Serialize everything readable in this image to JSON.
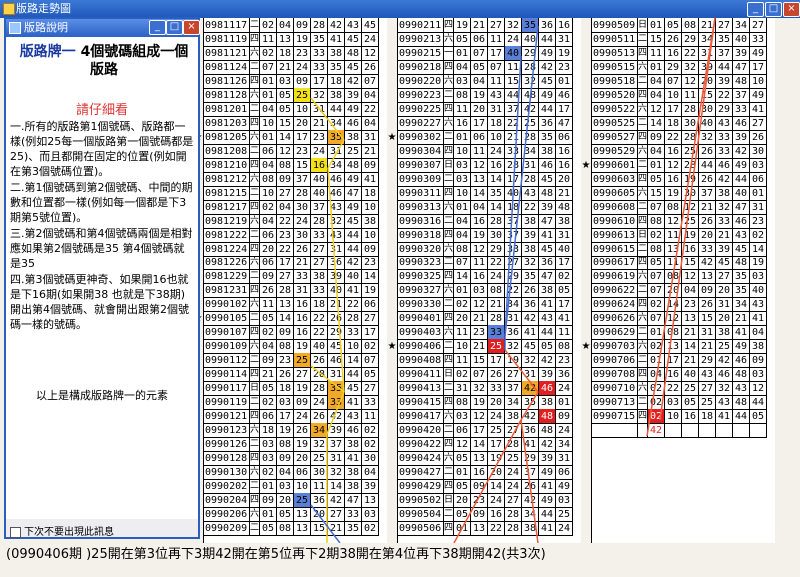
{
  "window": {
    "title": "版路走勢圖"
  },
  "popup": {
    "title": "版路說明",
    "heading_part1": "版路牌一",
    "heading_part2": "4個號碼組成一個版路",
    "subheading": "請仔細看",
    "items": [
      "一.所有的版路第1個號碼、版路都一樣(例如25每一個版路第一個號碼都是25)、而且都開在固定的位置(例如開在第3個號碼位置)。",
      "二.第1個號碼到第2個號碼、中間的期數和位置都一樣(例如每一個都是下3期第5號位置)。",
      "三.第2個號碼和第4個號碼兩個是相對應如果第2個號碼是35 第4個號碼就是35",
      "四.第3個號碼更神奇、如果開16也就是下16期(如果開38 也就是下38期)開出第4個號碼、就會開出跟第2個號碼一樣的號碼。"
    ],
    "conclusion": "以上是構成版路牌一的元素",
    "checkbox_label": "下次不要出現此訊息"
  },
  "status": "(0990406期 )25開在第3位再下3期42開在第5位再下2期38開在第4位再下38期開42(共3次)",
  "colors": {
    "yellow": "#f4e218",
    "orange": "#f2a92a",
    "red": "#e02020",
    "blue": "#5a7fd8",
    "line_red": "#ee5a3a",
    "line_yellow": "#f0d020",
    "line_blue": "#4a6fd0"
  },
  "columns": [
    {
      "rows": [
        [
          "0981117",
          "二",
          "02",
          "04",
          "09",
          "28",
          "42",
          "43",
          "45"
        ],
        [
          "0981119",
          "四",
          "11",
          "13",
          "19",
          "35",
          "41",
          "45",
          "24"
        ],
        [
          "0981121",
          "六",
          "02",
          "18",
          "23",
          "33",
          "38",
          "48",
          "12"
        ],
        [
          "0981124",
          "二",
          "07",
          "21",
          "24",
          "33",
          "35",
          "45",
          "26"
        ],
        [
          "0981126",
          "四",
          "01",
          "03",
          "09",
          "17",
          "18",
          "42",
          "07"
        ],
        [
          "0981128",
          "六",
          "01",
          "05",
          "25",
          "32",
          "38",
          "39",
          "04"
        ],
        [
          "0981201",
          "二",
          "04",
          "05",
          "10",
          "31",
          "44",
          "49",
          "22"
        ],
        [
          "0981203",
          "四",
          "10",
          "15",
          "20",
          "21",
          "34",
          "46",
          "04"
        ],
        [
          "0981205",
          "六",
          "01",
          "14",
          "17",
          "23",
          "35",
          "38",
          "31"
        ],
        [
          "0981208",
          "二",
          "06",
          "12",
          "23",
          "24",
          "31",
          "25",
          "21"
        ],
        [
          "0981210",
          "四",
          "04",
          "08",
          "15",
          "16",
          "34",
          "48",
          "09"
        ],
        [
          "0981212",
          "六",
          "08",
          "09",
          "37",
          "40",
          "46",
          "49",
          "41"
        ],
        [
          "0981215",
          "二",
          "10",
          "27",
          "28",
          "40",
          "46",
          "47",
          "18"
        ],
        [
          "0981217",
          "四",
          "02",
          "04",
          "30",
          "37",
          "43",
          "49",
          "10"
        ],
        [
          "0981219",
          "六",
          "04",
          "22",
          "24",
          "28",
          "32",
          "45",
          "38"
        ],
        [
          "0981222",
          "二",
          "06",
          "23",
          "30",
          "33",
          "43",
          "44",
          "10"
        ],
        [
          "0981224",
          "四",
          "20",
          "22",
          "26",
          "27",
          "31",
          "44",
          "09"
        ],
        [
          "0981226",
          "六",
          "06",
          "17",
          "21",
          "27",
          "36",
          "42",
          "23"
        ],
        [
          "0981229",
          "二",
          "09",
          "27",
          "33",
          "38",
          "39",
          "40",
          "14"
        ],
        [
          "0981231",
          "四",
          "26",
          "28",
          "31",
          "33",
          "40",
          "41",
          "19"
        ],
        [
          "0990102",
          "六",
          "11",
          "13",
          "16",
          "18",
          "21",
          "22",
          "06"
        ],
        [
          "0990105",
          "二",
          "05",
          "14",
          "16",
          "22",
          "26",
          "28",
          "27"
        ],
        [
          "0990107",
          "四",
          "02",
          "09",
          "16",
          "22",
          "29",
          "33",
          "17"
        ],
        [
          "0990109",
          "六",
          "04",
          "08",
          "19",
          "40",
          "45",
          "10",
          "02"
        ],
        [
          "0990112",
          "二",
          "09",
          "23",
          "25",
          "26",
          "46",
          "14",
          "07"
        ],
        [
          "0990114",
          "四",
          "21",
          "26",
          "27",
          "28",
          "31",
          "44",
          "05"
        ],
        [
          "0990117",
          "日",
          "05",
          "18",
          "19",
          "28",
          "35",
          "45",
          "27"
        ],
        [
          "0990119",
          "二",
          "02",
          "03",
          "09",
          "24",
          "33",
          "41",
          "33"
        ],
        [
          "0990121",
          "四",
          "06",
          "17",
          "24",
          "26",
          "42",
          "43",
          "11"
        ],
        [
          "0990123",
          "六",
          "18",
          "19",
          "26",
          "34",
          "39",
          "46",
          "02"
        ],
        [
          "0990126",
          "二",
          "03",
          "08",
          "19",
          "32",
          "37",
          "38",
          "02"
        ],
        [
          "0990128",
          "四",
          "03",
          "09",
          "20",
          "25",
          "31",
          "41",
          "30"
        ],
        [
          "0990130",
          "六",
          "02",
          "04",
          "06",
          "30",
          "32",
          "38",
          "04"
        ],
        [
          "0990202",
          "二",
          "01",
          "03",
          "10",
          "11",
          "14",
          "38",
          "39"
        ],
        [
          "0990204",
          "四",
          "09",
          "20",
          "25",
          "36",
          "42",
          "47",
          "13"
        ],
        [
          "0990206",
          "六",
          "01",
          "05",
          "13",
          "20",
          "27",
          "33",
          "03"
        ],
        [
          "0990209",
          "二",
          "05",
          "08",
          "13",
          "15",
          "21",
          "35",
          "02"
        ]
      ]
    },
    {
      "rows": [
        [
          "0990211",
          "四",
          "19",
          "21",
          "27",
          "32",
          "35",
          "36",
          "16"
        ],
        [
          "0990213",
          "六",
          "05",
          "06",
          "11",
          "24",
          "40",
          "44",
          "31"
        ],
        [
          "0990215",
          "一",
          "01",
          "07",
          "17",
          "40",
          "29",
          "49",
          "19"
        ],
        [
          "0990218",
          "四",
          "04",
          "05",
          "07",
          "11",
          "28",
          "42",
          "23"
        ],
        [
          "0990220",
          "六",
          "03",
          "04",
          "11",
          "15",
          "32",
          "45",
          "01"
        ],
        [
          "0990223",
          "二",
          "08",
          "19",
          "43",
          "44",
          "48",
          "49",
          "46"
        ],
        [
          "0990225",
          "四",
          "11",
          "20",
          "31",
          "37",
          "42",
          "44",
          "17"
        ],
        [
          "0990227",
          "六",
          "16",
          "17",
          "18",
          "22",
          "25",
          "36",
          "47"
        ],
        [
          "0990302",
          "二",
          "01",
          "06",
          "10",
          "21",
          "28",
          "35",
          "06"
        ],
        [
          "0990304",
          "四",
          "10",
          "11",
          "24",
          "33",
          "34",
          "38",
          "16"
        ],
        [
          "0990307",
          "日",
          "03",
          "12",
          "16",
          "28",
          "31",
          "46",
          "16"
        ],
        [
          "0990309",
          "二",
          "03",
          "13",
          "14",
          "17",
          "28",
          "45",
          "20"
        ],
        [
          "0990311",
          "四",
          "10",
          "14",
          "35",
          "40",
          "43",
          "48",
          "21"
        ],
        [
          "0990313",
          "六",
          "01",
          "04",
          "14",
          "18",
          "22",
          "39",
          "48"
        ],
        [
          "0990316",
          "二",
          "04",
          "16",
          "28",
          "37",
          "38",
          "47",
          "38"
        ],
        [
          "0990318",
          "四",
          "04",
          "19",
          "30",
          "37",
          "39",
          "41",
          "31"
        ],
        [
          "0990320",
          "六",
          "08",
          "12",
          "29",
          "33",
          "38",
          "45",
          "40"
        ],
        [
          "0990323",
          "二",
          "07",
          "11",
          "22",
          "27",
          "32",
          "36",
          "17"
        ],
        [
          "0990325",
          "四",
          "14",
          "16",
          "24",
          "29",
          "35",
          "47",
          "02"
        ],
        [
          "0990327",
          "六",
          "01",
          "03",
          "08",
          "22",
          "26",
          "38",
          "05"
        ],
        [
          "0990330",
          "二",
          "02",
          "12",
          "21",
          "34",
          "36",
          "41",
          "17"
        ],
        [
          "0990401",
          "四",
          "20",
          "21",
          "28",
          "31",
          "42",
          "43",
          "41"
        ],
        [
          "0990403",
          "六",
          "11",
          "23",
          "33",
          "36",
          "41",
          "44",
          "11"
        ],
        [
          "0990406",
          "二",
          "10",
          "21",
          "25",
          "32",
          "45",
          "05",
          "08"
        ],
        [
          "0990408",
          "四",
          "11",
          "15",
          "17",
          "19",
          "32",
          "42",
          "23"
        ],
        [
          "0990411",
          "日",
          "02",
          "07",
          "26",
          "27",
          "31",
          "39",
          "36"
        ],
        [
          "0990413",
          "二",
          "31",
          "32",
          "33",
          "37",
          "42",
          "46",
          "24"
        ],
        [
          "0990415",
          "四",
          "08",
          "19",
          "20",
          "34",
          "35",
          "38",
          "01"
        ],
        [
          "0990417",
          "六",
          "03",
          "12",
          "24",
          "38",
          "42",
          "48",
          "09"
        ],
        [
          "0990420",
          "二",
          "06",
          "17",
          "25",
          "27",
          "36",
          "48",
          "24"
        ],
        [
          "0990422",
          "四",
          "12",
          "14",
          "17",
          "28",
          "41",
          "42",
          "34"
        ],
        [
          "0990424",
          "六",
          "05",
          "13",
          "19",
          "25",
          "29",
          "39",
          "31"
        ],
        [
          "0990427",
          "二",
          "01",
          "16",
          "20",
          "24",
          "37",
          "49",
          "06"
        ],
        [
          "0990429",
          "四",
          "05",
          "09",
          "14",
          "24",
          "26",
          "41",
          "49"
        ],
        [
          "0990502",
          "日",
          "20",
          "23",
          "24",
          "27",
          "42",
          "49",
          "03"
        ],
        [
          "0990504",
          "二",
          "05",
          "09",
          "16",
          "28",
          "34",
          "44",
          "25"
        ],
        [
          "0990506",
          "四",
          "01",
          "13",
          "22",
          "28",
          "38",
          "41",
          "24"
        ]
      ]
    },
    {
      "rows": [
        [
          "0990509",
          "日",
          "01",
          "05",
          "08",
          "21",
          "27",
          "34",
          "27"
        ],
        [
          "0990511",
          "二",
          "15",
          "26",
          "29",
          "34",
          "35",
          "40",
          "33"
        ],
        [
          "0990513",
          "四",
          "11",
          "16",
          "22",
          "31",
          "37",
          "39",
          "49"
        ],
        [
          "0990515",
          "六",
          "01",
          "29",
          "32",
          "39",
          "44",
          "47",
          "17"
        ],
        [
          "0990518",
          "二",
          "04",
          "07",
          "12",
          "20",
          "39",
          "48",
          "10"
        ],
        [
          "0990520",
          "四",
          "04",
          "10",
          "11",
          "15",
          "22",
          "37",
          "49"
        ],
        [
          "0990522",
          "六",
          "12",
          "17",
          "28",
          "30",
          "29",
          "33",
          "41"
        ],
        [
          "0990525",
          "二",
          "14",
          "18",
          "30",
          "40",
          "43",
          "46",
          "27"
        ],
        [
          "0990527",
          "四",
          "09",
          "22",
          "28",
          "32",
          "33",
          "39",
          "26"
        ],
        [
          "0990529",
          "六",
          "04",
          "16",
          "25",
          "26",
          "33",
          "42",
          "30"
        ],
        [
          "0990601",
          "二",
          "01",
          "12",
          "28",
          "44",
          "46",
          "49",
          "03"
        ],
        [
          "0990603",
          "四",
          "05",
          "16",
          "19",
          "26",
          "42",
          "44",
          "06"
        ],
        [
          "0990605",
          "六",
          "15",
          "19",
          "30",
          "37",
          "38",
          "40",
          "01"
        ],
        [
          "0990608",
          "二",
          "07",
          "08",
          "12",
          "21",
          "32",
          "47",
          "31"
        ],
        [
          "0990610",
          "四",
          "08",
          "12",
          "25",
          "26",
          "33",
          "46",
          "23"
        ],
        [
          "0990613",
          "日",
          "02",
          "11",
          "19",
          "20",
          "21",
          "43",
          "02"
        ],
        [
          "0990615",
          "二",
          "08",
          "13",
          "16",
          "33",
          "39",
          "45",
          "14"
        ],
        [
          "0990617",
          "四",
          "05",
          "11",
          "15",
          "42",
          "45",
          "48",
          "19"
        ],
        [
          "0990619",
          "六",
          "07",
          "08",
          "12",
          "13",
          "27",
          "35",
          "03"
        ],
        [
          "0990622",
          "二",
          "07",
          "20",
          "04",
          "09",
          "20",
          "35",
          "40"
        ],
        [
          "0990624",
          "四",
          "02",
          "14",
          "23",
          "26",
          "31",
          "34",
          "43"
        ],
        [
          "0990626",
          "六",
          "07",
          "12",
          "13",
          "15",
          "20",
          "21",
          "41"
        ],
        [
          "0990629",
          "二",
          "01",
          "08",
          "21",
          "31",
          "38",
          "41",
          "04"
        ],
        [
          "0990703",
          "六",
          "02",
          "13",
          "14",
          "21",
          "25",
          "49",
          "38"
        ],
        [
          "0990706",
          "二",
          "01",
          "17",
          "21",
          "29",
          "42",
          "46",
          "09"
        ],
        [
          "0990708",
          "四",
          "04",
          "16",
          "40",
          "43",
          "46",
          "48",
          "03"
        ],
        [
          "0990710",
          "六",
          "02",
          "22",
          "25",
          "27",
          "32",
          "43",
          "12"
        ],
        [
          "0990713",
          "二",
          "02",
          "03",
          "05",
          "25",
          "43",
          "48",
          "44"
        ],
        [
          "0990715",
          "四",
          "02",
          "10",
          "16",
          "18",
          "41",
          "44",
          "05"
        ],
        [
          "",
          "",
          "42",
          "",
          "",
          "",
          "",
          "",
          ""
        ]
      ]
    }
  ]
}
